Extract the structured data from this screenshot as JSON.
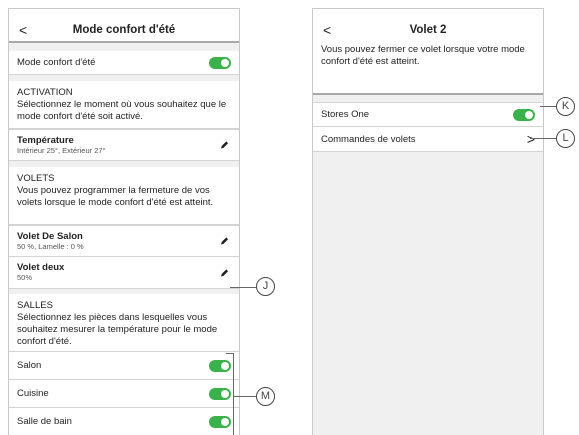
{
  "left": {
    "header": {
      "back": "<",
      "title": "Mode confort d'été"
    },
    "mode_row": {
      "label": "Mode confort d'été",
      "toggle_on": true
    },
    "activation": {
      "title": "ACTIVATION",
      "desc": "Sélectionnez le moment où vous souhaitez que le mode confort d'été soit activé.",
      "temp_title": "Température",
      "temp_sub": "Intérieur 25°, Extérieur 27°"
    },
    "volets": {
      "title": "VOLETS",
      "desc": "Vous pouvez programmer la fermeture de vos volets lorsque le mode confort d'été est atteint.",
      "items": [
        {
          "title": "Volet De Salon",
          "sub": "50 %, Lamelle : 0 %"
        },
        {
          "title": "Volet deux",
          "sub": "50%"
        }
      ]
    },
    "salles": {
      "title": "SALLES",
      "desc": "Sélectionnez les pièces dans lesquelles vous souhaitez mesurer la température pour le mode confort d'été.",
      "rooms": [
        {
          "label": "Salon",
          "toggle_on": true
        },
        {
          "label": "Cuisine",
          "toggle_on": true
        },
        {
          "label": "Salle de bain",
          "toggle_on": true
        }
      ]
    }
  },
  "right": {
    "header": {
      "back": "<",
      "title": "Volet 2"
    },
    "desc": "Vous pouvez fermer ce volet lorsque votre mode confort d'été est atteint.",
    "rows": [
      {
        "label": "Stores One",
        "toggle_on": true
      },
      {
        "label": "Commandes de volets",
        "chevron": ">"
      }
    ]
  },
  "callouts": {
    "j": "J",
    "k": "K",
    "l": "L",
    "m": "M"
  },
  "colors": {
    "toggle_on": "#3ab14a",
    "background": "#f0f0f0"
  }
}
